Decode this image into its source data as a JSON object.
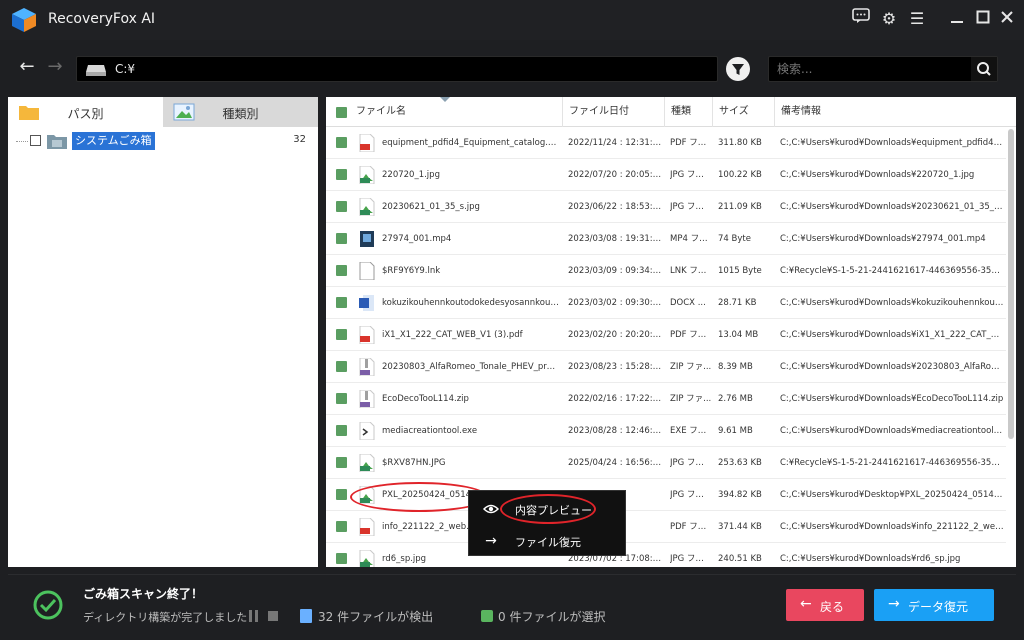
{
  "app": {
    "title": "RecoveryFox AI"
  },
  "toolbar": {
    "path": "C:¥",
    "search_placeholder": "検索..."
  },
  "left_panel": {
    "tabs": [
      {
        "label": "パス別"
      },
      {
        "label": "種類別"
      }
    ],
    "tree": {
      "label": "システムごみ箱",
      "count": "32"
    }
  },
  "table": {
    "columns": [
      "ファイル名",
      "ファイル日付",
      "種類",
      "サイズ",
      "備考情報"
    ],
    "rows": [
      {
        "name": "equipment_pdfid4_Equipment_catalog.pdf",
        "date": "2022/11/24 : 12:31:48",
        "type": "PDF ファ...",
        "size": "311.80 KB",
        "info": "C:,C:¥Users¥kurod¥Downloads¥equipment_pdfid4_Equ...",
        "icon": "pdf-icon"
      },
      {
        "name": "220720_1.jpg",
        "date": "2022/07/20 : 20:05:08",
        "type": "JPG ファ...",
        "size": "100.22 KB",
        "info": "C:,C:¥Users¥kurod¥Downloads¥220720_1.jpg",
        "icon": "jpg-icon"
      },
      {
        "name": "20230621_01_35_s.jpg",
        "date": "2023/06/22 : 18:53:24",
        "type": "JPG ファ...",
        "size": "211.09 KB",
        "info": "C:,C:¥Users¥kurod¥Downloads¥20230621_01_35_s.jpg",
        "icon": "jpg-icon"
      },
      {
        "name": "27974_001.mp4",
        "date": "2023/03/08 : 19:31:14",
        "type": "MP4 ファ...",
        "size": "74 Byte",
        "info": "C:,C:¥Users¥kurod¥Downloads¥27974_001.mp4",
        "icon": "mp4-icon"
      },
      {
        "name": "$RF9Y6Y9.lnk",
        "date": "2023/03/09 : 09:34:34",
        "type": "LNK ファ...",
        "size": "1015 Byte",
        "info": "C:¥Recycle¥S-1-5-21-2441621617-446369556-357571...",
        "icon": "lnk-icon"
      },
      {
        "name": "kokuzikouhennkoutodokedesyosannkourei....",
        "date": "2023/03/02 : 09:30:34",
        "type": "DOCX ...",
        "size": "28.71 KB",
        "info": "C:,C:¥Users¥kurod¥Downloads¥kokuzikouhennkoutod...",
        "icon": "word-icon"
      },
      {
        "name": "iX1_X1_222_CAT_WEB_V1 (3).pdf",
        "date": "2023/02/20 : 20:20:18",
        "type": "PDF ファ...",
        "size": "13.04 MB",
        "info": "C:,C:¥Users¥kurod¥Downloads¥iX1_X1_222_CAT_WEB...",
        "icon": "pdf-icon"
      },
      {
        "name": "20230803_AlfaRomeo_Tonale_PHEV_press...",
        "date": "2023/08/23 : 15:28:00",
        "type": "ZIP ファ...",
        "size": "8.39 MB",
        "info": "C:,C:¥Users¥kurod¥Downloads¥20230803_AlfaRomeo...",
        "icon": "zip-icon"
      },
      {
        "name": "EcoDecoTooL114.zip",
        "date": "2022/02/16 : 17:22:06",
        "type": "ZIP ファ...",
        "size": "2.76 MB",
        "info": "C:,C:¥Users¥kurod¥Downloads¥EcoDecoTooL114.zip",
        "icon": "zip-icon"
      },
      {
        "name": "mediacreationtool.exe",
        "date": "2023/08/28 : 12:46:02",
        "type": "EXE ファ...",
        "size": "9.61 MB",
        "info": "C:,C:¥Users¥kurod¥Downloads¥mediacreationtool.exe",
        "icon": "exe-icon"
      },
      {
        "name": "$RXV87HN.JPG",
        "date": "2025/04/24 : 16:56:26",
        "type": "JPG ファ...",
        "size": "253.63 KB",
        "info": "C:¥Recycle¥S-1-5-21-2441621617-446369556-357571...",
        "icon": "jpg-icon"
      },
      {
        "name": "PXL_20250424_05145",
        "date": "...5:57:36",
        "type": "JPG ファ...",
        "size": "394.82 KB",
        "info": "C:,C:¥Users¥kurod¥Desktop¥PXL_20250424_0514597...",
        "icon": "jpg-icon"
      },
      {
        "name": "info_221122_2_web.p",
        "date": "...2:30:36",
        "type": "PDF ファ...",
        "size": "371.44 KB",
        "info": "C:,C:¥Users¥kurod¥Downloads¥info_221122_2_web.pdf",
        "icon": "pdf-icon"
      },
      {
        "name": "rd6_sp.jpg",
        "date": "2023/07/02 : 17:08:14",
        "type": "JPG ファ...",
        "size": "240.51 KB",
        "info": "C:,C:¥Users¥kurod¥Downloads¥rd6_sp.jpg",
        "icon": "jpg-icon"
      }
    ]
  },
  "context_menu": {
    "items": [
      {
        "label": "内容プレビュー",
        "icon": "eye-icon"
      },
      {
        "label": "ファイル復元",
        "icon": "arrow-right-icon"
      }
    ]
  },
  "status": {
    "title": "ごみ箱スキャン終了！",
    "subtitle": "ディレクトリ構築が完了しました",
    "found": "32 件ファイルが検出",
    "selected": "0 件ファイルが選択"
  },
  "buttons": {
    "back": "戻る",
    "recover": "データ復元"
  },
  "colors": {
    "accent_blue": "#1aa0f5",
    "back_red": "#e9475f",
    "check_green": "#5a9e61",
    "selection_blue": "#2a73d6"
  }
}
